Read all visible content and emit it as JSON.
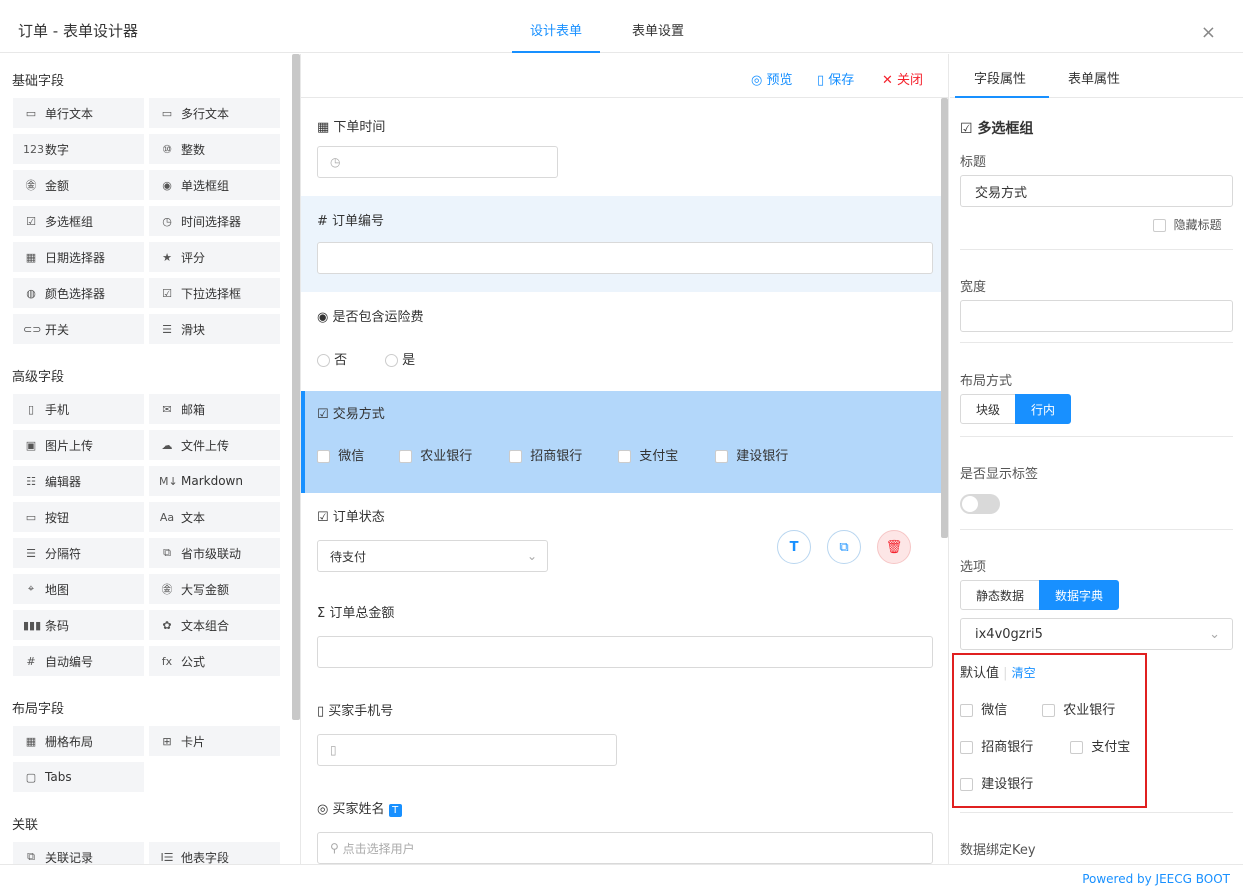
{
  "header": {
    "title": "订单 - 表单设计器",
    "tabs": [
      "设计表单",
      "表单设置"
    ],
    "close_icon": "×"
  },
  "left": {
    "groups": [
      {
        "title": "基础字段",
        "items": [
          {
            "icon": "single-line-icon",
            "glyph": "▭",
            "label": "单行文本"
          },
          {
            "icon": "multi-line-icon",
            "glyph": "▭",
            "label": "多行文本"
          },
          {
            "icon": "number-icon",
            "glyph": "123",
            "label": "数字"
          },
          {
            "icon": "integer-icon",
            "glyph": "⑩",
            "label": "整数"
          },
          {
            "icon": "money-icon",
            "glyph": "㊎",
            "label": "金额"
          },
          {
            "icon": "radio-icon",
            "glyph": "◉",
            "label": "单选框组"
          },
          {
            "icon": "checkbox-icon",
            "glyph": "☑",
            "label": "多选框组"
          },
          {
            "icon": "clock-icon",
            "glyph": "◷",
            "label": "时间选择器"
          },
          {
            "icon": "calendar-icon",
            "glyph": "▦",
            "label": "日期选择器"
          },
          {
            "icon": "star-icon",
            "glyph": "★",
            "label": "评分"
          },
          {
            "icon": "palette-icon",
            "glyph": "◍",
            "label": "颜色选择器"
          },
          {
            "icon": "select-icon",
            "glyph": "☑",
            "label": "下拉选择框"
          },
          {
            "icon": "toggle-icon",
            "glyph": "⊂⊃",
            "label": "开关"
          },
          {
            "icon": "slider-icon",
            "glyph": "☰",
            "label": "滑块"
          }
        ]
      },
      {
        "title": "高级字段",
        "items": [
          {
            "icon": "phone-icon",
            "glyph": "▯",
            "label": "手机"
          },
          {
            "icon": "mail-icon",
            "glyph": "✉",
            "label": "邮箱"
          },
          {
            "icon": "image-icon",
            "glyph": "▣",
            "label": "图片上传"
          },
          {
            "icon": "cloud-upload-icon",
            "glyph": "☁",
            "label": "文件上传"
          },
          {
            "icon": "editor-icon",
            "glyph": "☷",
            "label": "编辑器"
          },
          {
            "icon": "markdown-icon",
            "glyph": "M↓",
            "label": "Markdown"
          },
          {
            "icon": "button-icon",
            "glyph": "▭",
            "label": "按钮"
          },
          {
            "icon": "text-icon",
            "glyph": "Aa",
            "label": "文本"
          },
          {
            "icon": "divider-icon",
            "glyph": "☰",
            "label": "分隔符"
          },
          {
            "icon": "region-icon",
            "glyph": "⧉",
            "label": "省市级联动"
          },
          {
            "icon": "map-icon",
            "glyph": "⌖",
            "label": "地图"
          },
          {
            "icon": "capital-money-icon",
            "glyph": "㊎",
            "label": "大写金额"
          },
          {
            "icon": "barcode-icon",
            "glyph": "▮▮▮",
            "label": "条码"
          },
          {
            "icon": "text-group-icon",
            "glyph": "✿",
            "label": "文本组合"
          },
          {
            "icon": "hash-icon",
            "glyph": "#",
            "label": "自动编号"
          },
          {
            "icon": "formula-icon",
            "glyph": "fx",
            "label": "公式"
          }
        ]
      },
      {
        "title": "布局字段",
        "items": [
          {
            "icon": "grid-icon",
            "glyph": "▦",
            "label": "栅格布局"
          },
          {
            "icon": "card-icon",
            "glyph": "⊞",
            "label": "卡片"
          },
          {
            "icon": "tabs-icon",
            "glyph": "▢",
            "label": "Tabs"
          }
        ]
      },
      {
        "title": "关联",
        "items": [
          {
            "icon": "link-record-icon",
            "glyph": "⧉",
            "label": "关联记录"
          },
          {
            "icon": "other-field-icon",
            "glyph": "I☰",
            "label": "他表字段"
          }
        ]
      }
    ]
  },
  "center": {
    "toolbar": {
      "preview": "预览",
      "save": "保存",
      "close": "关闭"
    },
    "fields": {
      "order_time": {
        "label": "下单时间"
      },
      "order_no": {
        "label": "订单编号"
      },
      "shipping": {
        "label": "是否包含运险费",
        "options": [
          "否",
          "是"
        ]
      },
      "payment": {
        "label": "交易方式",
        "options": [
          "微信",
          "农业银行",
          "招商银行",
          "支付宝",
          "建设银行"
        ]
      },
      "status": {
        "label": "订单状态",
        "value": "待支付"
      },
      "amount": {
        "label": "订单总金额"
      },
      "phone": {
        "label": "买家手机号"
      },
      "buyer": {
        "label": "买家姓名",
        "placeholder": "点击选择用户"
      }
    }
  },
  "right": {
    "tabs": [
      "字段属性",
      "表单属性"
    ],
    "component": "多选框组",
    "title_label": "标题",
    "title_value": "交易方式",
    "hide_title": "隐藏标题",
    "width_label": "宽度",
    "layout_label": "布局方式",
    "layout_options": [
      "块级",
      "行内"
    ],
    "show_label": "是否显示标签",
    "options_label": "选项",
    "options_modes": [
      "静态数据",
      "数据字典"
    ],
    "dict_value": "ix4v0gzri5",
    "default_label": "默认值",
    "clear": "清空",
    "default_options": [
      "微信",
      "农业银行",
      "招商银行",
      "支付宝",
      "建设银行"
    ],
    "bind_key_label": "数据绑定Key"
  },
  "footer": {
    "powered": "Powered by JEECG BOOT"
  },
  "colors": {
    "accent": "#1890ff",
    "selected_bg": "#b3d7fa",
    "highlight_bg": "#ecf4fc",
    "danger": "#f5222d",
    "annotation": "#e02020"
  }
}
